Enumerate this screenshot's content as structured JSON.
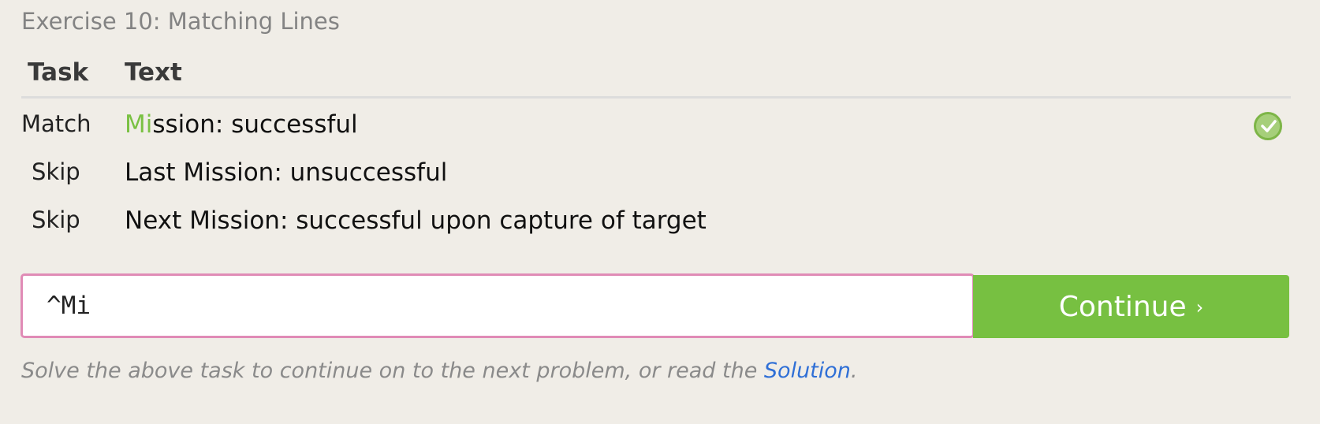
{
  "exercise_title": "Exercise 10: Matching Lines",
  "table": {
    "headers": {
      "task": "Task",
      "text": "Text"
    },
    "rows": [
      {
        "task": "Match",
        "text_highlight": "Mi",
        "text_rest": "ssion: successful",
        "status_icon": "check-circle-icon",
        "status_color": "#7ac143"
      },
      {
        "task": "Skip",
        "text": "Last Mission: unsuccessful"
      },
      {
        "task": "Skip",
        "text": "Next Mission: successful upon capture of target"
      }
    ]
  },
  "input": {
    "value": "^Mi",
    "border_color": "#e08bb6"
  },
  "continue_button": {
    "label": "Continue",
    "chevron": "›",
    "color": "#77c041"
  },
  "hint": {
    "prefix": "Solve the above task to continue on to the next problem, or read the ",
    "link": "Solution",
    "suffix": "."
  },
  "colors": {
    "background": "#f0ede7",
    "link": "#2f6fd6"
  }
}
